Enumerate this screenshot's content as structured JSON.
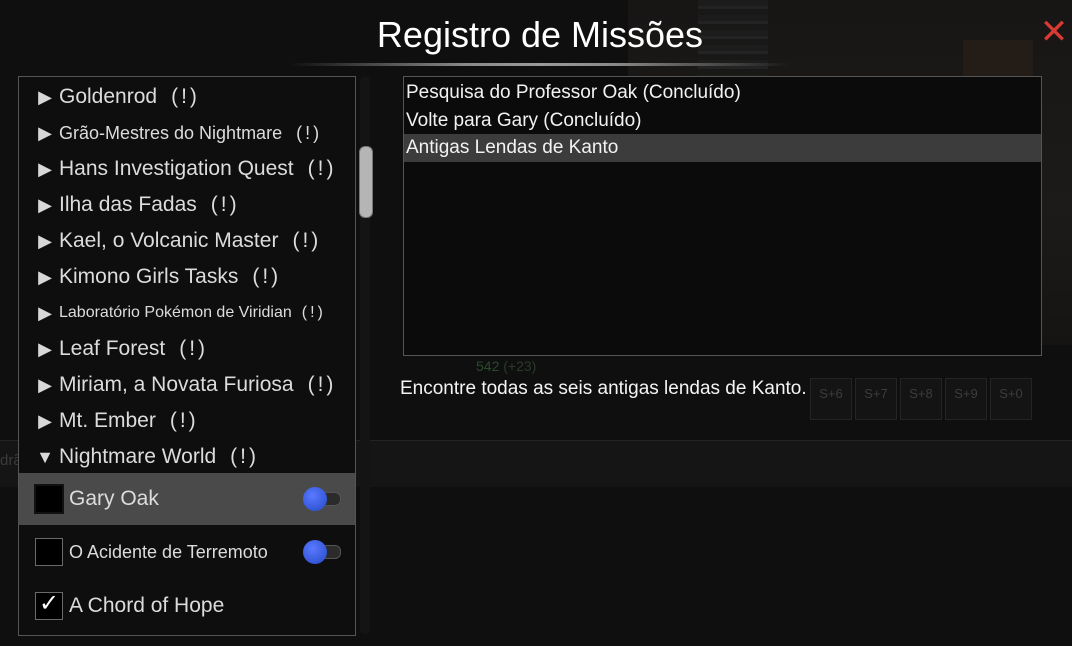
{
  "dialog": {
    "title": "Registro de Missões",
    "close_glyph": "✕"
  },
  "background": {
    "xp_value": "542",
    "xp_gain": "(+23)",
    "left_text": "drão",
    "hotbar": [
      "S+6",
      "S+7",
      "S+8",
      "S+9",
      "S+0"
    ]
  },
  "quest_tree": {
    "groups": [
      {
        "label": "Goldenrod",
        "marker": "(!)",
        "expanded": false
      },
      {
        "label": "Grão-Mestres do Nightmare",
        "marker": "(!)",
        "expanded": false
      },
      {
        "label": "Hans Investigation Quest",
        "marker": "(!)",
        "expanded": false
      },
      {
        "label": "Ilha das Fadas",
        "marker": "(!)",
        "expanded": false
      },
      {
        "label": "Kael, o Volcanic Master",
        "marker": "(!)",
        "expanded": false
      },
      {
        "label": "Kimono Girls Tasks",
        "marker": "(!)",
        "expanded": false
      },
      {
        "label": "Laboratório Pokémon de Viridian",
        "marker": "(!)",
        "expanded": false
      },
      {
        "label": "Leaf Forest",
        "marker": "(!)",
        "expanded": false
      },
      {
        "label": "Miriam, a Novata Furiosa",
        "marker": "(!)",
        "expanded": false
      },
      {
        "label": "Mt. Ember",
        "marker": "(!)",
        "expanded": false
      },
      {
        "label": "Nightmare World",
        "marker": "(!)",
        "expanded": true
      }
    ],
    "sub_items": [
      {
        "label": "Gary Oak",
        "checked": false,
        "selected": true,
        "tracking": true
      },
      {
        "label": "O Acidente de Terremoto",
        "checked": false,
        "selected": false,
        "tracking": true
      },
      {
        "label": "A Chord of Hope",
        "checked": true,
        "selected": false,
        "tracking": false
      }
    ],
    "arrow_collapsed": "▶",
    "arrow_expanded": "▼",
    "check_glyph": "✓"
  },
  "tasks": [
    {
      "label": "Pesquisa do Professor Oak (Concluído)",
      "selected": false
    },
    {
      "label": "Volte para Gary (Concluído)",
      "selected": false
    },
    {
      "label": "Antigas Lendas de Kanto",
      "selected": true
    }
  ],
  "description": "Encontre todas as seis antigas lendas de Kanto.",
  "colors": {
    "accent_close": "#d93a34",
    "toggle_on": "#3457d8",
    "selected_row": "#4a4a4a"
  }
}
